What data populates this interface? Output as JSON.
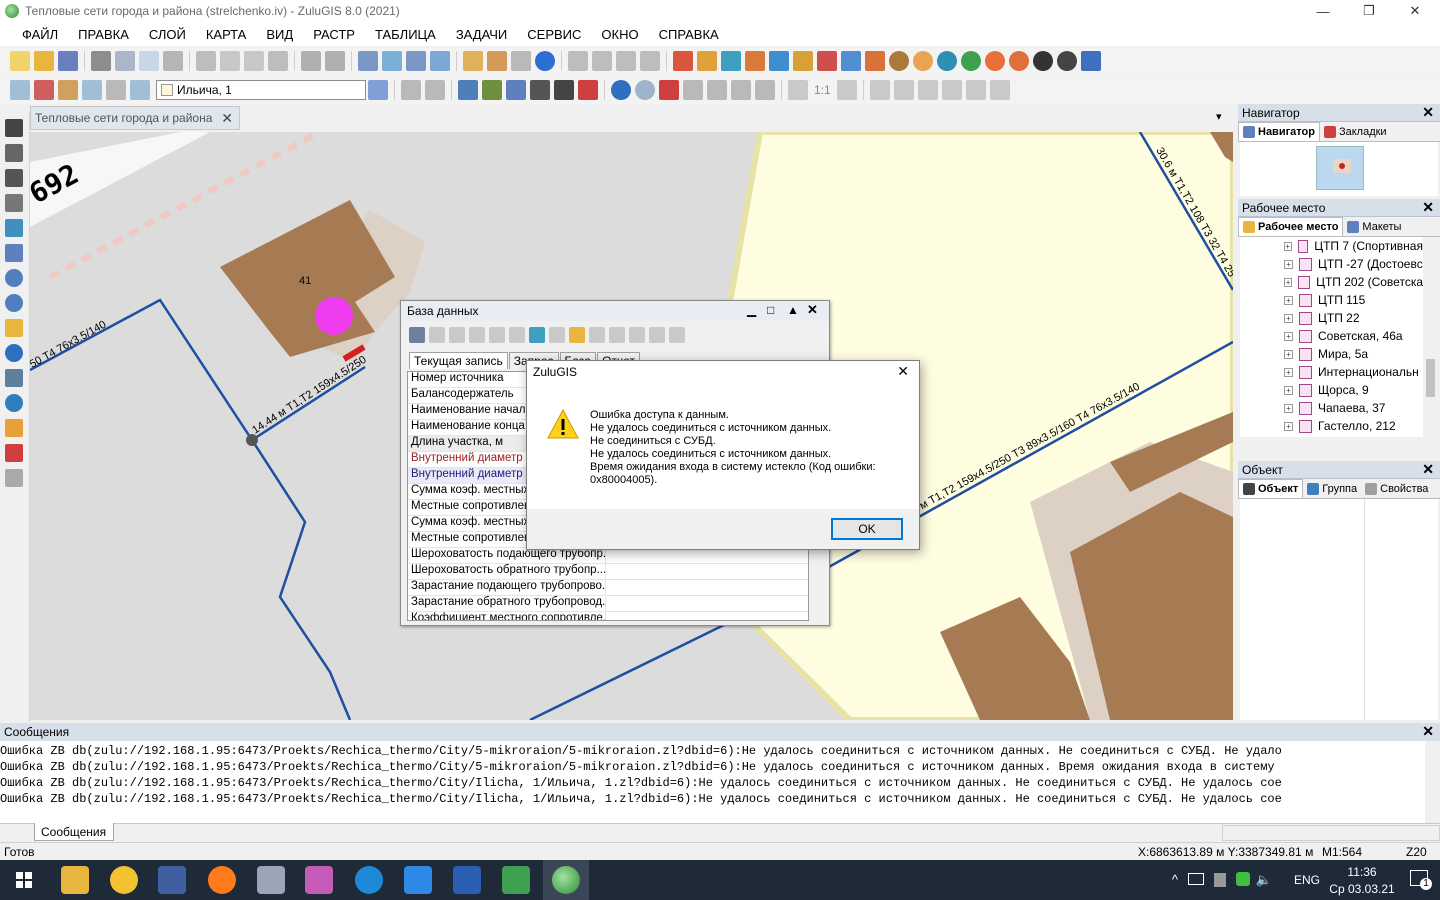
{
  "window": {
    "title": "Тепловые сети города и района (strelchenko.iv) - ZuluGIS 8.0 (2021)",
    "controls": {
      "minimize": "—",
      "maximize": "❐",
      "close": "✕"
    }
  },
  "menu": [
    "ФАЙЛ",
    "ПРАВКА",
    "СЛОЙ",
    "КАРТА",
    "ВИД",
    "РАСТР",
    "ТАБЛИЦА",
    "ЗАДАЧИ",
    "СЕРВИС",
    "ОКНО",
    "СПРАВКА"
  ],
  "toolbar2": {
    "layer_combo": "Ильича, 1",
    "scale_label": "1:1"
  },
  "map": {
    "tab_title": "Тепловые сети города и района",
    "labels": {
      "house_number": "41",
      "pipe_a": "14.44 м Т1,Т2 159х4.5/250",
      "pipe_b": "50  Т4 76х3.5/140",
      "pipe_c": "4 м Т1,Т2 159х4.5/250 Т3 89х3.5/160 Т4 76х3.5/140",
      "pipe_d": "30.6 м Т1,Т2 108 Т3 32  Т4 25",
      "street_number": "692"
    }
  },
  "navigator": {
    "title": "Навигатор",
    "tabs": [
      "Навигатор",
      "Закладки"
    ]
  },
  "workspace": {
    "title": "Рабочее место",
    "tabs": [
      "Рабочее место",
      "Макеты"
    ],
    "items": [
      "ЦТП 7 (Спортивная",
      "ЦТП -27 (Достоевс",
      "ЦТП 202 (Советска",
      "ЦТП 115",
      "ЦТП 22",
      "Советская, 46а",
      "Мира, 5а",
      "Интернациональн",
      "Щорса, 9",
      "Чапаева, 37",
      "Гастелло, 212"
    ]
  },
  "object_panel": {
    "title": "Объект",
    "tabs": [
      "Объект",
      "Группа",
      "Свойства"
    ]
  },
  "database_window": {
    "title": "База данных",
    "tabs": [
      "Текущая запись",
      "Запрос",
      "База",
      "Отчет"
    ],
    "fields": [
      "Номер источника",
      "Балансодержатель",
      "Наименование начала участка",
      "Наименование конца участка",
      "Длина участка, м",
      "Внутренний диаметр подающего трубопровода",
      "Внутренний диаметр обратного трубопровода",
      "Сумма коэф. местных сопротивлений",
      "Местные сопротивления",
      "Сумма коэф. местных сопротивлений",
      "Местные сопротивления",
      "Шероховатость подающего трубопр...",
      "Шероховатость обратного трубопр...",
      "Зарастание подающего трубопрово...",
      "Зарастание обратного трубопровод...",
      "Коэффициент местного сопротивле..."
    ]
  },
  "error_dialog": {
    "title": "ZuluGIS",
    "lines": [
      "Ошибка доступа к данным.",
      "Не удалось соединиться с источником данных.",
      "Не соединиться с СУБД.",
      "Не удалось соединиться с источником данных.",
      "Время ожидания входа в систему истекло (Код ошибки:",
      "0x80004005)."
    ],
    "ok_label": "OK",
    "close": "✕"
  },
  "messages": {
    "title": "Сообщения",
    "tab": "Сообщения",
    "lines": [
      "Ошибка ZB db(zulu://192.168.1.95:6473/Proekts/Rechica_thermo/City/5-mikroraion/5-mikroraion.zl?dbid=6):Не удалось соединиться с источником данных. Не соединиться с СУБД. Не удало",
      "Ошибка ZB db(zulu://192.168.1.95:6473/Proekts/Rechica_thermo/City/5-mikroraion/5-mikroraion.zl?dbid=6):Не удалось соединиться с источником данных. Время ожидания входа в систему",
      "Ошибка ZB db(zulu://192.168.1.95:6473/Proekts/Rechica_thermo/City/Ilicha, 1/Ильича, 1.zl?dbid=6):Не удалось соединиться с источником данных. Не соединиться с СУБД. Не удалось сое",
      "Ошибка ZB db(zulu://192.168.1.95:6473/Proekts/Rechica_thermo/City/Ilicha, 1/Ильича, 1.zl?dbid=6):Не удалось соединиться с источником данных. Не соединиться с СУБД. Не удалось сое"
    ]
  },
  "status": {
    "state": "Готов",
    "coords": "X:6863613.89 м  Y:3387349.81 м",
    "scale": "M1:564",
    "zoom": "Z20"
  },
  "taskbar": {
    "lang": "ENG",
    "time": "11:36",
    "date": "Ср 03.03.21",
    "notif_count": "1"
  },
  "colors": {
    "accent": "#0078d7",
    "pipe": "#1f4fa0",
    "building": "#a67b54",
    "node": "#f03cf0",
    "parcel": "#fffde0"
  }
}
